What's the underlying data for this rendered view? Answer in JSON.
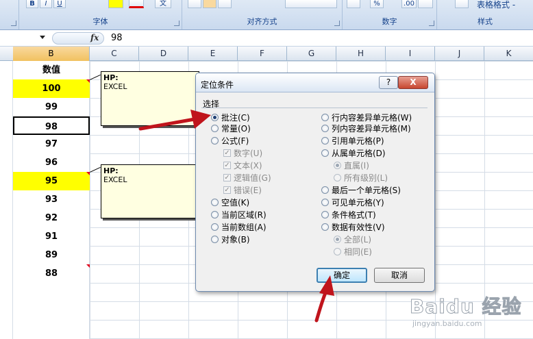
{
  "ribbon": {
    "font_group": "字体",
    "align_group": "对齐方式",
    "number_group": "数字",
    "style_group": "样式",
    "bold": "B",
    "italic": "I",
    "underline": "U",
    "table_format": "表格格式 -",
    "percent": "%",
    "decimal": ".00",
    "style_sample": "文"
  },
  "formula_bar": {
    "fx": "fx",
    "value": "98"
  },
  "columns": [
    "B",
    "C",
    "D",
    "E",
    "F",
    "G",
    "H",
    "I",
    "J",
    "K"
  ],
  "cells": [
    "数值",
    "100",
    "99",
    "98",
    "97",
    "96",
    "95",
    "93",
    "92",
    "91",
    "89",
    "88"
  ],
  "comments": [
    {
      "author": "HP:",
      "text": "EXCEL"
    },
    {
      "author": "HP:",
      "text": "EXCEL"
    }
  ],
  "dialog": {
    "title": "定位条件",
    "help": "?",
    "close": "X",
    "section": "选择",
    "left_options": [
      "批注(C)",
      "常量(O)",
      "公式(F)",
      "数字(U)",
      "文本(X)",
      "逻辑值(G)",
      "错误(E)",
      "空值(K)",
      "当前区域(R)",
      "当前数组(A)",
      "对象(B)"
    ],
    "right_options": [
      "行内容差异单元格(W)",
      "列内容差异单元格(M)",
      "引用单元格(P)",
      "从属单元格(D)",
      "直属(I)",
      "所有级别(L)",
      "最后一个单元格(S)",
      "可见单元格(Y)",
      "条件格式(T)",
      "数据有效性(V)",
      "全部(L)",
      "相同(E)"
    ],
    "ok": "确定",
    "cancel": "取消"
  },
  "watermark": {
    "brand": "Baidu 经验",
    "url": "jingyan.baidu.com"
  },
  "colors": {
    "highlight": "#ffff00",
    "comment_bg": "#ffffe1",
    "annotation_arrow": "#c0141c",
    "comment_flag": "#e0001b"
  }
}
